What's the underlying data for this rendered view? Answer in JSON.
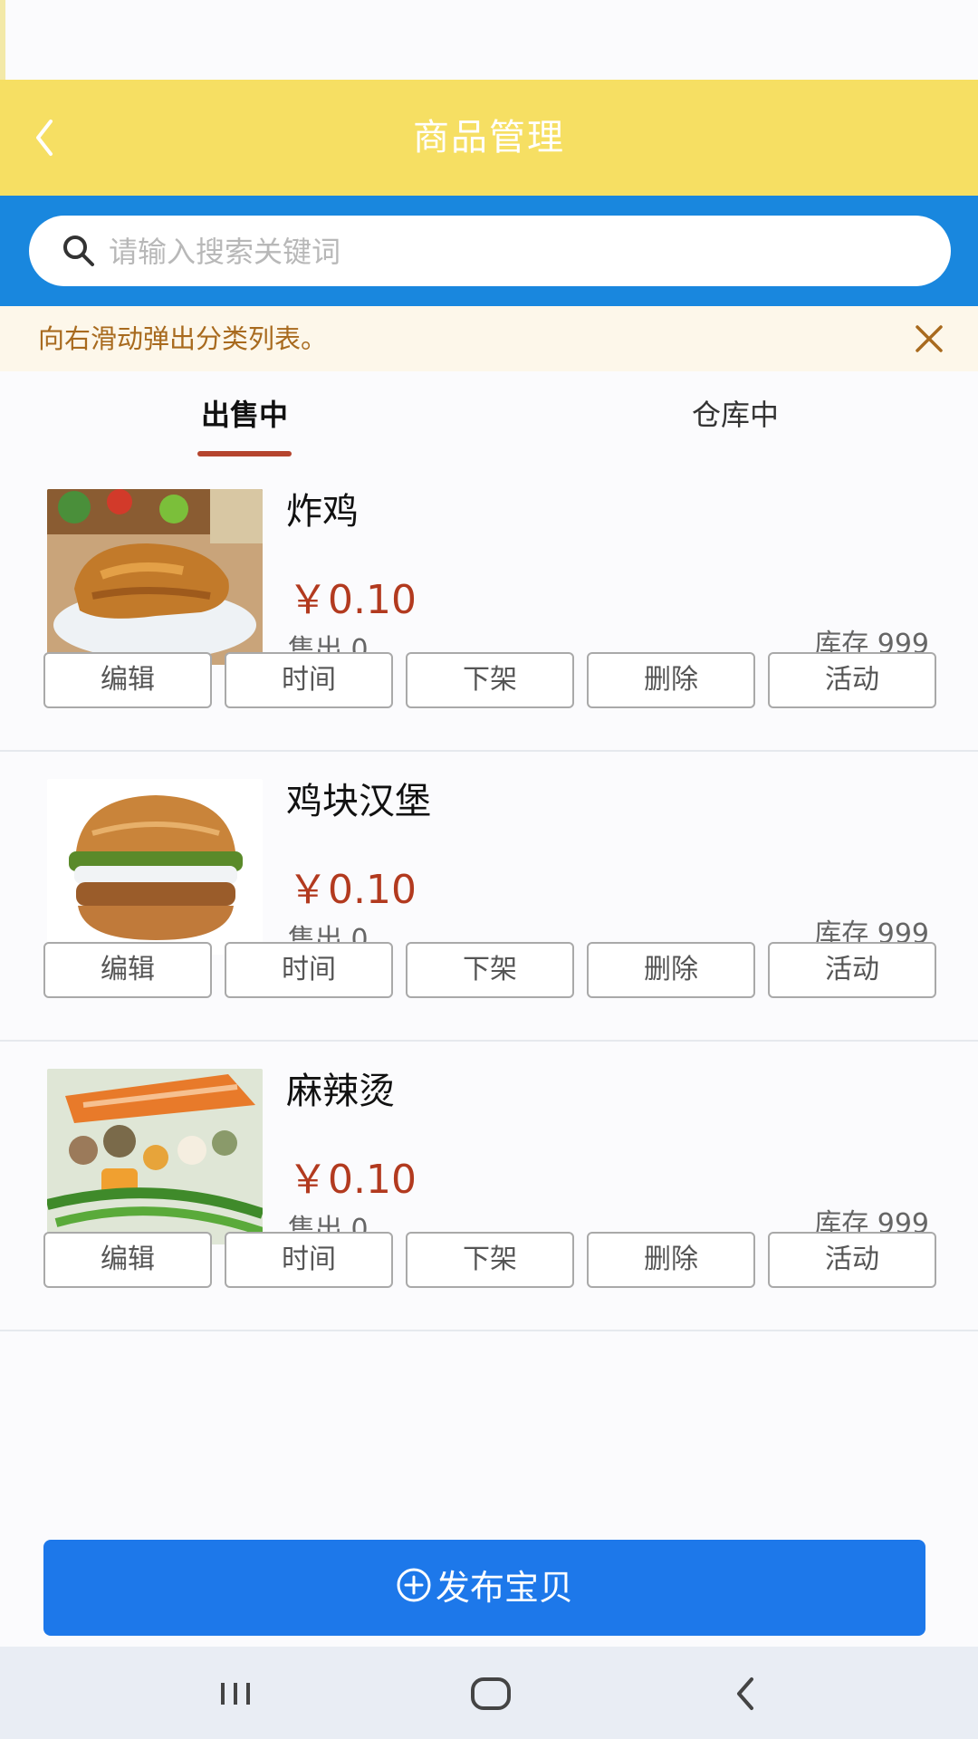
{
  "header": {
    "title": "商品管理",
    "back_icon": "chevron-left-icon"
  },
  "search": {
    "placeholder": "请输入搜索关键词",
    "icon": "search-icon"
  },
  "notice": {
    "text": "向右滑动弹出分类列表。",
    "close_icon": "close-icon"
  },
  "tabs": [
    {
      "label": "出售中",
      "active": true
    },
    {
      "label": "仓库中",
      "active": false
    }
  ],
  "products": [
    {
      "name": "炸鸡",
      "price": "￥0.10",
      "sold": "售出 0",
      "stock": "库存 999",
      "image": "fried-chicken"
    },
    {
      "name": "鸡块汉堡",
      "price": "￥0.10",
      "sold": "售出 0",
      "stock": "库存 999",
      "image": "burger"
    },
    {
      "name": "麻辣烫",
      "price": "￥0.10",
      "sold": "售出 0",
      "stock": "库存 999",
      "image": "malatang"
    }
  ],
  "actions": [
    "编辑",
    "时间",
    "下架",
    "删除",
    "活动"
  ],
  "publish": {
    "label": "发布宝贝",
    "icon": "plus-circle-icon"
  },
  "navbar": {
    "recent_icon": "recent-apps-icon",
    "home_icon": "home-icon",
    "back_icon": "back-icon"
  },
  "colors": {
    "header_bg": "#f6df63",
    "search_bg": "#1987de",
    "price": "#b23a1f",
    "publish_bg": "#1d78ea",
    "tab_underline": "#b5442e"
  }
}
